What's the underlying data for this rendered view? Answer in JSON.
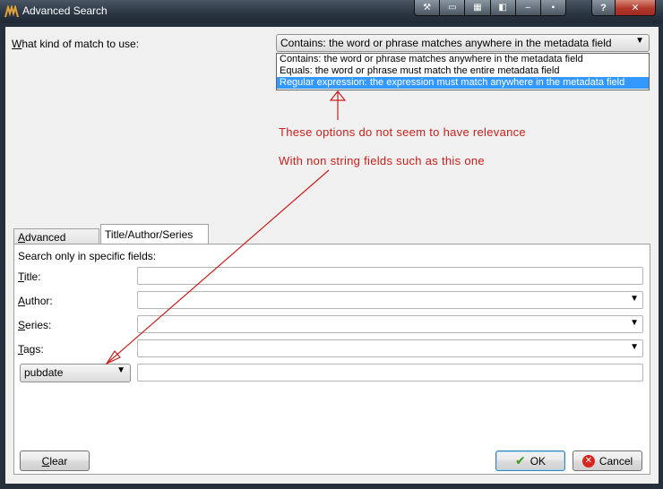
{
  "window": {
    "title": "Advanced Search",
    "title_buttons": [
      "wrench-icon",
      "window-icon",
      "grid-icon",
      "pin-icon",
      "minimize-icon",
      "maximize-icon"
    ],
    "help_label": "?",
    "close_label": "✕"
  },
  "match": {
    "label_underlined": "W",
    "label_rest": "hat kind of match to use:",
    "selected": "Contains: the word or phrase matches anywhere in the metadata field",
    "options": [
      "Contains: the word or phrase matches anywhere in the metadata field",
      "Equals: the word or phrase must match the entire metadata field",
      "Regular expression: the expression must match anywhere in the metadata field"
    ],
    "highlighted_index": 2
  },
  "annotations": {
    "line1": "These options do not seem to have relevance",
    "line2": "With non string fields such as this one",
    "color": "#c8201c"
  },
  "tabs": [
    {
      "label_underlined": "A",
      "label_rest": "dvanced Search"
    },
    {
      "label": "Title/Author/Series ..."
    }
  ],
  "panel": {
    "heading": "Search only in specific fields:",
    "fields": [
      {
        "underlined": "T",
        "rest": "itle:",
        "value": ""
      },
      {
        "underlined": "A",
        "rest": "uthor:",
        "value": ""
      },
      {
        "underlined": "S",
        "rest": "eries:",
        "value": ""
      },
      {
        "underlined": "T",
        "rest": "ags:",
        "value": ""
      }
    ],
    "extra_field": {
      "selected": "pubdate",
      "value": ""
    }
  },
  "buttons": {
    "clear_underlined": "C",
    "clear_rest": "lear",
    "ok": "OK",
    "cancel": "Cancel"
  }
}
